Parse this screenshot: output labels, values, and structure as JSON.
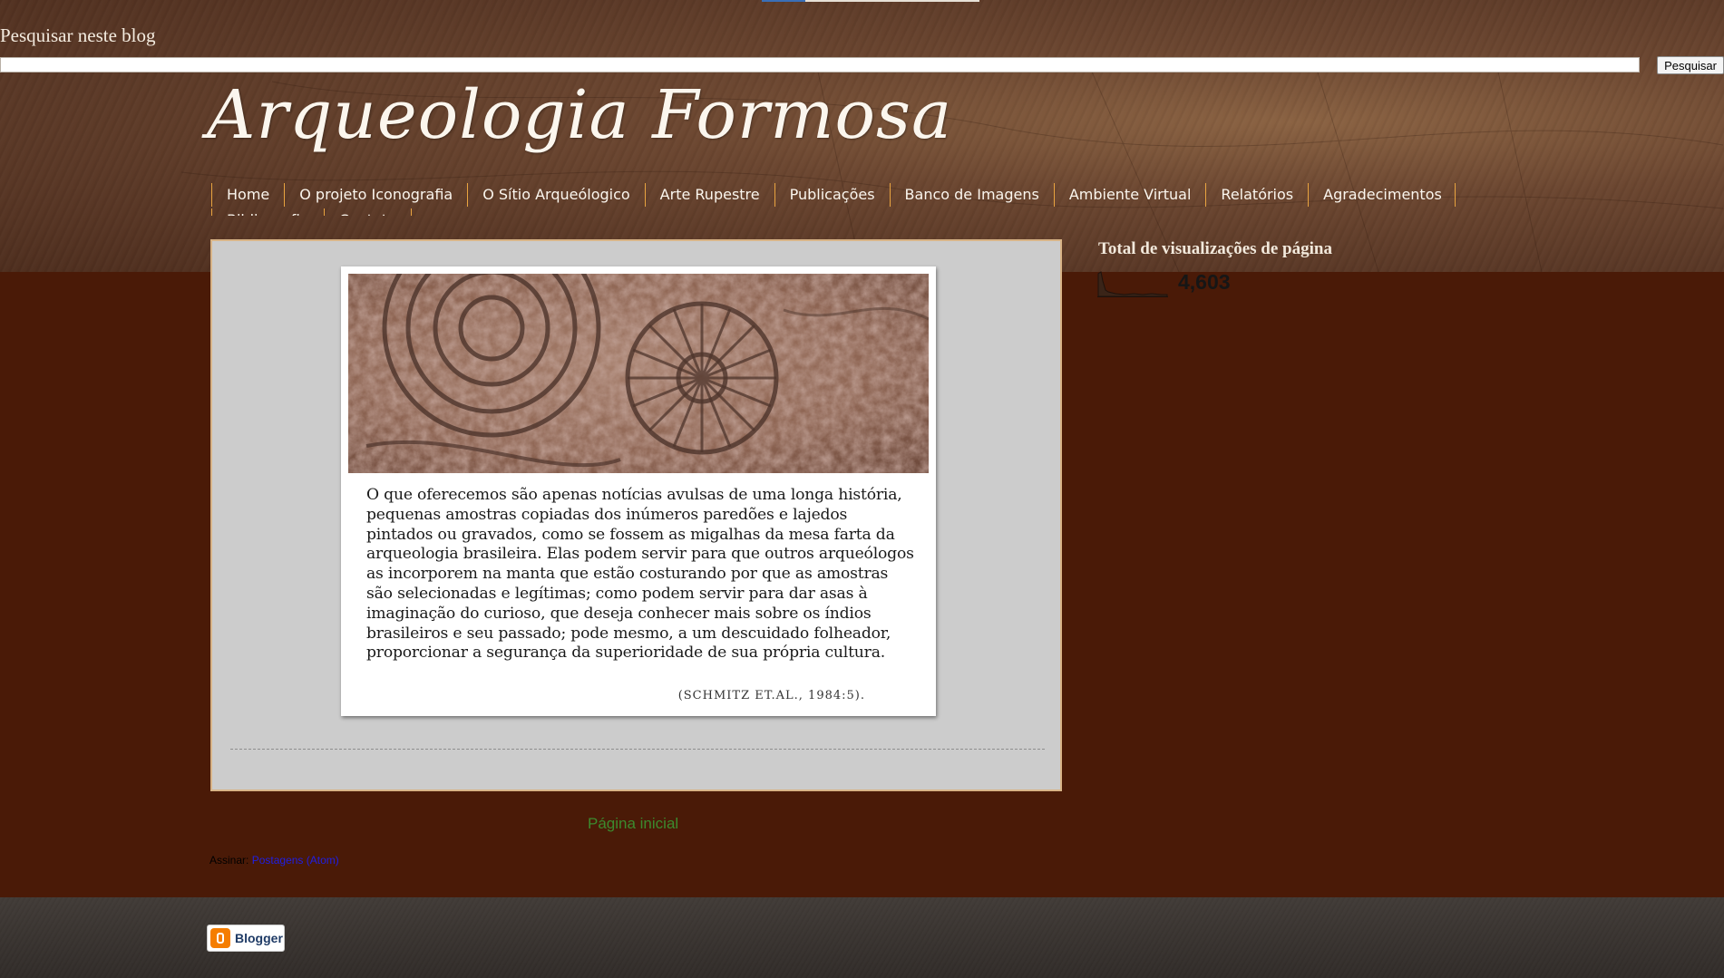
{
  "search": {
    "title": "Pesquisar neste blog",
    "value": "",
    "placeholder": "",
    "button_label": "Pesquisar"
  },
  "header": {
    "blog_title": "Arqueologia Formosa"
  },
  "nav": {
    "items": [
      {
        "label": "Home"
      },
      {
        "label": "O projeto Iconografia"
      },
      {
        "label": "O Sítio Arqueólogico"
      },
      {
        "label": "Arte Rupestre"
      },
      {
        "label": "Publicações"
      },
      {
        "label": "Banco de Imagens"
      },
      {
        "label": "Ambiente Virtual"
      },
      {
        "label": "Relatórios"
      },
      {
        "label": "Agradecimentos"
      },
      {
        "label": "Bibliografia"
      },
      {
        "label": "Contato"
      }
    ]
  },
  "post": {
    "image_icon": "rock-engraving-photo",
    "quote": "O que oferecemos são apenas notícias avulsas de uma longa história, pequenas amostras copiadas dos inúmeros paredões e lajedos pintados ou gravados, como se fossem as migalhas da mesa farta da arqueologia brasileira. Elas podem servir para que outros arqueólogos as incorporem na manta que estão costurando por que as amostras são selecionadas e legítimas; como podem servir para dar asas à imaginação do curioso, que deseja conhecer mais sobre os índios brasileiros e seu passado; pode mesmo, a um descuidado folheador, proporcionar a segurança da superioridade de sua própria cultura.",
    "citation": "(SCHMITZ ET.AL., 1984:5)."
  },
  "pager": {
    "home_label": "Página inicial"
  },
  "subscribe": {
    "label": "Assinar:",
    "link_label": "Postagens (Atom)"
  },
  "sidebar": {
    "pageviews_title": "Total de visualizações de página",
    "pageviews_count": "4,603"
  },
  "footer": {
    "badge_label": "Blogger",
    "badge_icon": "blogger-logo-icon"
  },
  "colors": {
    "background": "#4a1a07",
    "nav_separator": "#e9a440",
    "panel": "#cccccc",
    "home_link": "#3c8a2e",
    "subscribe_link": "#1f1fe6"
  }
}
